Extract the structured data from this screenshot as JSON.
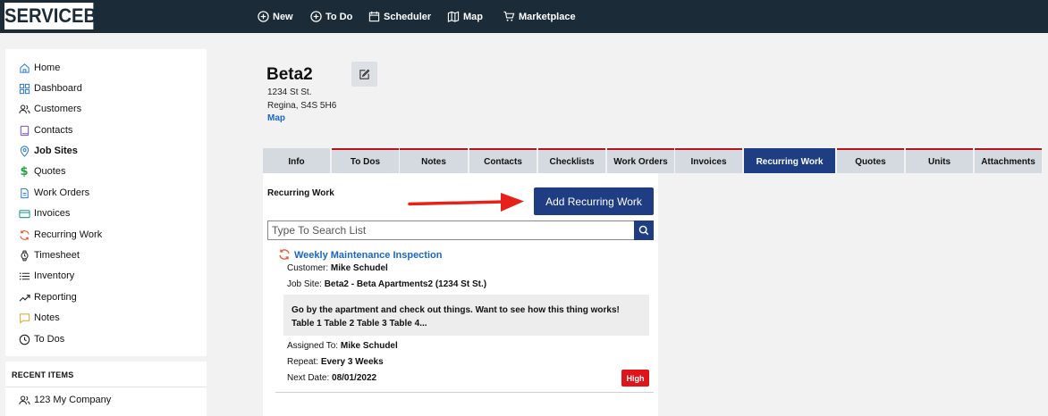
{
  "app": {
    "logo": "SERVICEBOX"
  },
  "topnav": [
    {
      "label": "New",
      "icon": "plus-circle-icon"
    },
    {
      "label": "To Do",
      "icon": "plus-circle-icon"
    },
    {
      "label": "Scheduler",
      "icon": "calendar-icon"
    },
    {
      "label": "Map",
      "icon": "map-icon"
    },
    {
      "label": "Marketplace",
      "icon": "cart-icon"
    }
  ],
  "sidebar": {
    "items": [
      {
        "label": "Home",
        "icon": "home-icon"
      },
      {
        "label": "Dashboard",
        "icon": "grid-icon"
      },
      {
        "label": "Customers",
        "icon": "users-icon"
      },
      {
        "label": "Contacts",
        "icon": "book-icon"
      },
      {
        "label": "Job Sites",
        "icon": "location-icon"
      },
      {
        "label": "Quotes",
        "icon": "dollar-icon"
      },
      {
        "label": "Work Orders",
        "icon": "document-icon"
      },
      {
        "label": "Invoices",
        "icon": "card-icon"
      },
      {
        "label": "Recurring Work",
        "icon": "refresh-icon"
      },
      {
        "label": "Timesheet",
        "icon": "watch-icon"
      },
      {
        "label": "Inventory",
        "icon": "list-icon"
      },
      {
        "label": "Reporting",
        "icon": "trend-icon"
      },
      {
        "label": "Notes",
        "icon": "comment-icon"
      },
      {
        "label": "To Dos",
        "icon": "clock-icon"
      }
    ],
    "active": "Job Sites"
  },
  "recent": {
    "title": "RECENT ITEMS",
    "items": [
      {
        "label": "123 My Company",
        "icon": "users-icon"
      }
    ]
  },
  "site": {
    "name": "Beta2",
    "address_line1": "1234 St St.",
    "address_line2": "Regina, S4S 5H6",
    "map_link": "Map"
  },
  "tabs": [
    "Info",
    "To Dos",
    "Notes",
    "Contacts",
    "Checklists",
    "Work Orders",
    "Invoices",
    "Recurring Work",
    "Quotes",
    "Units",
    "Attachments"
  ],
  "active_tab": "Recurring Work",
  "panel": {
    "title": "Recurring Work",
    "add_button": "Add Recurring Work",
    "search_placeholder": "Type To Search List"
  },
  "recurring_item": {
    "title": "Weekly Maintenance Inspection",
    "customer_label": "Customer:",
    "customer": "Mike Schudel",
    "jobsite_label": "Job Site:",
    "jobsite": "Beta2 - Beta Apartments2 (1234 St St.)",
    "description": "Go by the apartment and check out things. Want to see how this thing works! Table 1 Table 2 Table 3 Table 4...",
    "assigned_label": "Assigned To:",
    "assigned": "Mike Schudel",
    "repeat_label": "Repeat:",
    "repeat": "Every 3 Weeks",
    "next_label": "Next Date:",
    "next_date": "08/01/2022",
    "priority": "High"
  },
  "colors": {
    "topbar": "#1b2b38",
    "accent": "#1e3d82",
    "link": "#1a66c8",
    "priority_high": "#e0141b",
    "tab_border": "#b8141b"
  }
}
